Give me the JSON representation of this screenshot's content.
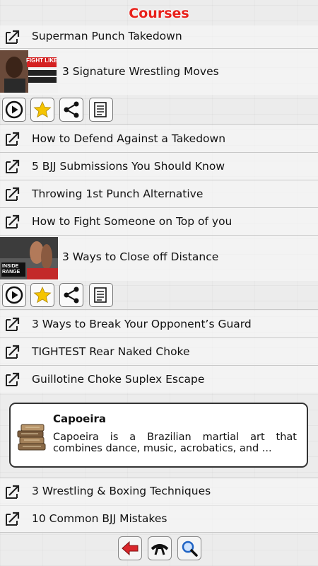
{
  "header": {
    "title": "Courses"
  },
  "items": [
    {
      "label": "Superman Punch Takedown"
    },
    {
      "label": "3 Signature Wrestling Moves",
      "thumb_text": "FIGHT LIKE"
    },
    {
      "label": "How to Defend Against a Takedown"
    },
    {
      "label": "5 BJJ Submissions You Should Know"
    },
    {
      "label": "Throwing 1st Punch Alternative"
    },
    {
      "label": "How to Fight Someone on Top of you"
    },
    {
      "label": "3 Ways to Close off Distance",
      "thumb_text": "INSIDE RANGE"
    },
    {
      "label": "3 Ways to Break Your Opponent’s Guard"
    },
    {
      "label": "TIGHTEST Rear Naked Choke"
    },
    {
      "label": "Guillotine Choke Suplex Escape"
    },
    {
      "label": "3 Wrestling & Boxing Techniques"
    },
    {
      "label": "10 Common BJJ Mistakes"
    }
  ],
  "card": {
    "title": "Capoeira",
    "description": "Capoeira is a Brazilian martial art that combines dance, music, acrobatics, and ..."
  },
  "colors": {
    "accent": "#e8211b",
    "star": "#f5c400",
    "back_arrow": "#d9262b",
    "search": "#1f63c4"
  },
  "icons": {
    "row": "external-link-icon",
    "actions": [
      "play-icon",
      "star-icon",
      "share-icon",
      "notes-icon"
    ],
    "bottom": [
      "back-arrow-icon",
      "belt-icon",
      "search-icon"
    ]
  }
}
